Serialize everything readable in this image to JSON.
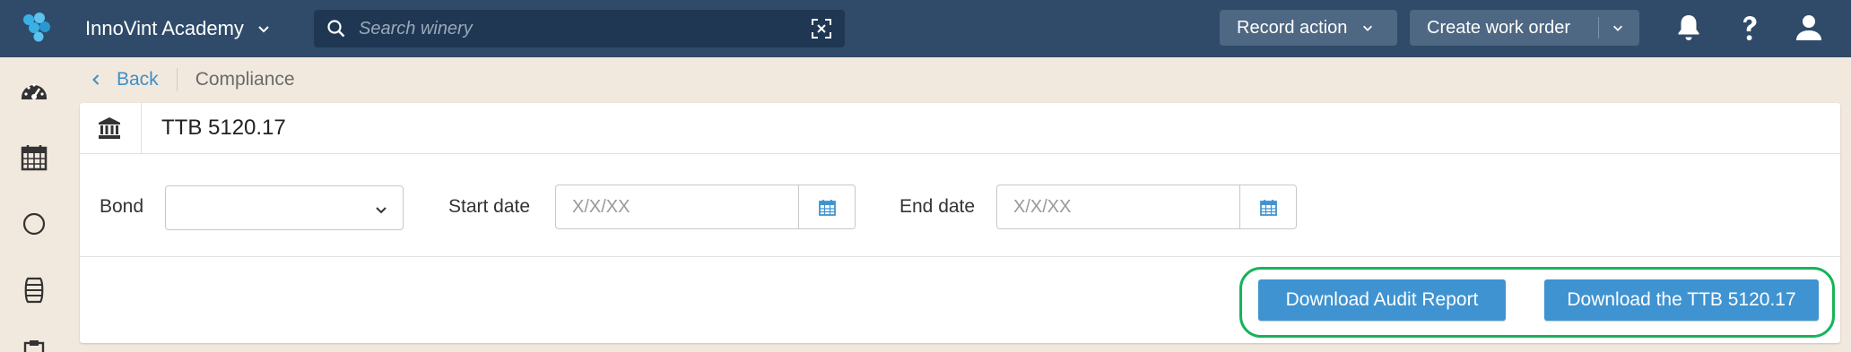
{
  "topbar": {
    "org_name": "InnoVint Academy",
    "search_placeholder": "Search winery",
    "record_action_label": "Record action",
    "create_work_order_label": "Create work order",
    "icons": [
      "bell-icon",
      "help-icon",
      "user-icon"
    ]
  },
  "sidebar": {
    "items": [
      "dashboard-icon",
      "calendar-icon",
      "circle-icon",
      "barrel-icon",
      "clipboard-icon"
    ]
  },
  "breadcrumb": {
    "back_label": "Back",
    "current": "Compliance"
  },
  "card": {
    "title": "TTB 5120.17",
    "bond_label": "Bond",
    "bond_value": "",
    "start_date_label": "Start date",
    "start_date_placeholder": "X/X/XX",
    "end_date_label": "End date",
    "end_date_placeholder": "X/X/XX",
    "download_audit_label": "Download Audit Report",
    "download_ttb_label": "Download the TTB 5120.17"
  },
  "colors": {
    "topbar": "#2f4b69",
    "page_bg": "#f2e9de",
    "primary_button": "#3f93d1",
    "highlight": "#17b35a",
    "link": "#3d8fc9"
  }
}
